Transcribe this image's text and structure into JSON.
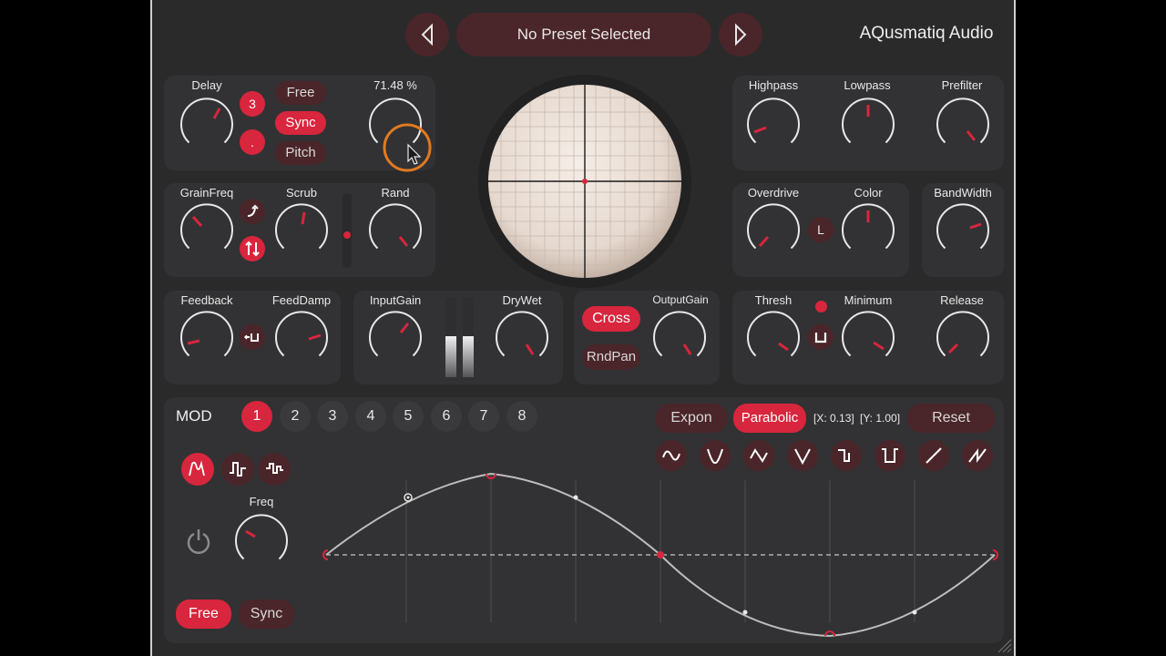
{
  "header": {
    "preset_name": "No Preset Selected",
    "brand": "AQusmatiq Audio"
  },
  "delay_panel": {
    "delay_label": "Delay",
    "num_label": "3",
    "dot_label": ".",
    "free_label": "Free",
    "sync_label": "Sync",
    "pitch_label": "Pitch",
    "percent_label": "71.48 %"
  },
  "grain_panel": {
    "grainfreq_label": "GrainFreq",
    "scrub_label": "Scrub",
    "rand_label": "Rand"
  },
  "feedback_panel": {
    "feedback_label": "Feedback",
    "feeddamp_label": "FeedDamp"
  },
  "gain_panel": {
    "inputgain_label": "InputGain",
    "drywet_label": "DryWet"
  },
  "output_panel": {
    "cross_label": "Cross",
    "rndpan_label": "RndPan",
    "outputgain_label": "OutputGain"
  },
  "filter_panel": {
    "highpass_label": "Highpass",
    "lowpass_label": "Lowpass",
    "prefilter_label": "Prefilter"
  },
  "drive_panel": {
    "overdrive_label": "Overdrive",
    "color_label": "Color",
    "l_label": "L"
  },
  "bandwidth_panel": {
    "bandwidth_label": "BandWidth"
  },
  "dynamics_panel": {
    "thresh_label": "Thresh",
    "minimum_label": "Minimum",
    "release_label": "Release"
  },
  "mod": {
    "title": "MOD",
    "slots": [
      "1",
      "2",
      "3",
      "4",
      "5",
      "6",
      "7",
      "8"
    ],
    "active_slot": "1",
    "expon_label": "Expon",
    "parabolic_label": "Parabolic",
    "x_readout": "[X: 0.13]",
    "y_readout": "[Y: 1.00]",
    "reset_label": "Reset",
    "freq_label": "Freq",
    "free_label": "Free",
    "sync_label": "Sync"
  },
  "colors": {
    "accent": "#d7263d",
    "panel": "#323234",
    "background": "#2a2a2b",
    "dark_red": "#4a2529"
  },
  "icons": {
    "prev": "triangle-left-icon",
    "next": "triangle-right-icon",
    "power": "power-icon",
    "cursor": "mouse-pointer-icon"
  }
}
